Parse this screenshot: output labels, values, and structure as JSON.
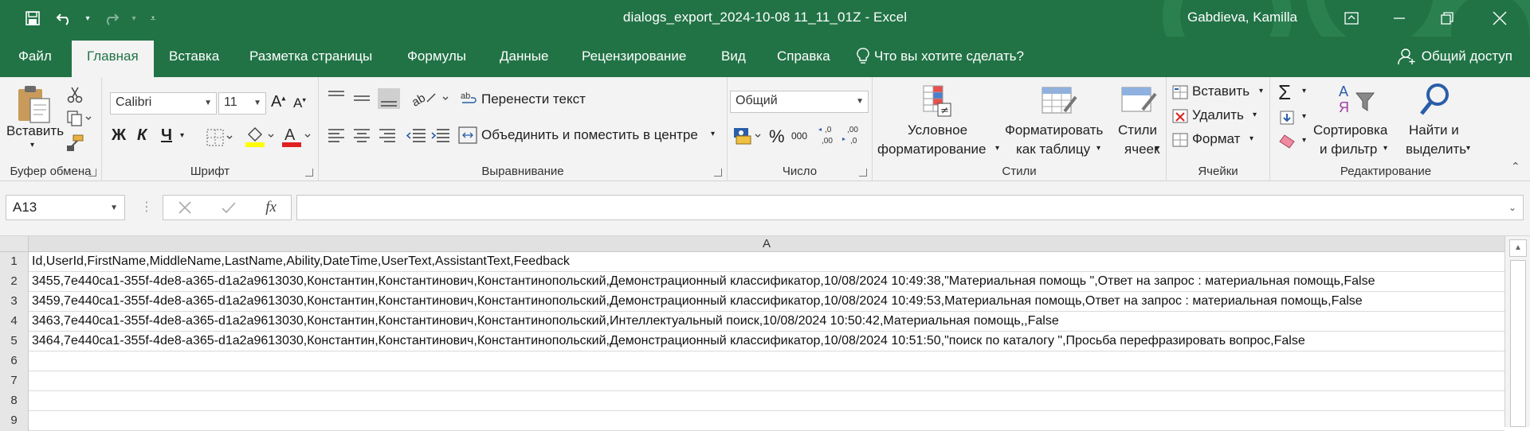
{
  "window": {
    "title": "dialogs_export_2024-10-08 11_11_01Z  -  Excel",
    "user": "Gabdieva, Kamilla"
  },
  "tabs": [
    {
      "label": "Файл"
    },
    {
      "label": "Главная"
    },
    {
      "label": "Вставка"
    },
    {
      "label": "Разметка страницы"
    },
    {
      "label": "Формулы"
    },
    {
      "label": "Данные"
    },
    {
      "label": "Рецензирование"
    },
    {
      "label": "Вид"
    },
    {
      "label": "Справка"
    }
  ],
  "tellme": "Что вы хотите сделать?",
  "share": "Общий доступ",
  "ribbon": {
    "clipboard": {
      "paste": "Вставить",
      "label": "Буфер обмена"
    },
    "font": {
      "name": "Calibri",
      "size": "11",
      "label": "Шрифт",
      "bold": "Ж",
      "italic": "К",
      "underline": "Ч"
    },
    "alignment": {
      "wrap": "Перенести текст",
      "merge": "Объединить и поместить в центре",
      "label": "Выравнивание"
    },
    "number": {
      "format": "Общий",
      "label": "Число",
      "percent": "%",
      "thousands": "000"
    },
    "styles": {
      "conditional_1": "Условное",
      "conditional_2": "форматирование",
      "table_1": "Форматировать",
      "table_2": "как таблицу",
      "cell_1": "Стили",
      "cell_2": "ячеек",
      "label": "Стили"
    },
    "cells": {
      "insert": "Вставить",
      "delete": "Удалить",
      "format": "Формат",
      "label": "Ячейки"
    },
    "editing": {
      "sort_1": "Сортировка",
      "sort_2": "и фильтр",
      "find_1": "Найти и",
      "find_2": "выделить",
      "label": "Редактирование"
    }
  },
  "formula_bar": {
    "name_box": "A13",
    "fx": "fx",
    "value": ""
  },
  "sheet": {
    "column": "A",
    "rows": [
      {
        "n": "1",
        "text": "Id,UserId,FirstName,MiddleName,LastName,Ability,DateTime,UserText,AssistantText,Feedback"
      },
      {
        "n": "2",
        "text": "3455,7e440ca1-355f-4de8-a365-d1a2a9613030,Константин,Константинович,Константинопольский,Демонстрационный классификатор,10/08/2024 10:49:38,\"Материальная помощь \",Ответ на запрос : материальная помощь,False"
      },
      {
        "n": "3",
        "text": "3459,7e440ca1-355f-4de8-a365-d1a2a9613030,Константин,Константинович,Константинопольский,Демонстрационный классификатор,10/08/2024 10:49:53,Материальная помощь,Ответ на запрос : материальная помощь,False"
      },
      {
        "n": "4",
        "text": "3463,7e440ca1-355f-4de8-a365-d1a2a9613030,Константин,Константинович,Константинопольский,Интеллектуальный поиск,10/08/2024 10:50:42,Материальная помощь,,False"
      },
      {
        "n": "5",
        "text": "3464,7e440ca1-355f-4de8-a365-d1a2a9613030,Константин,Константинович,Константинопольский,Демонстрационный классификатор,10/08/2024 10:51:50,\"поиск по каталогу \",Просьба перефразировать вопрос,False"
      },
      {
        "n": "6",
        "text": ""
      },
      {
        "n": "7",
        "text": ""
      },
      {
        "n": "8",
        "text": ""
      },
      {
        "n": "9",
        "text": ""
      }
    ]
  },
  "colors": {
    "accent": "#217346",
    "ribbon_bg": "#f3f3f3"
  }
}
